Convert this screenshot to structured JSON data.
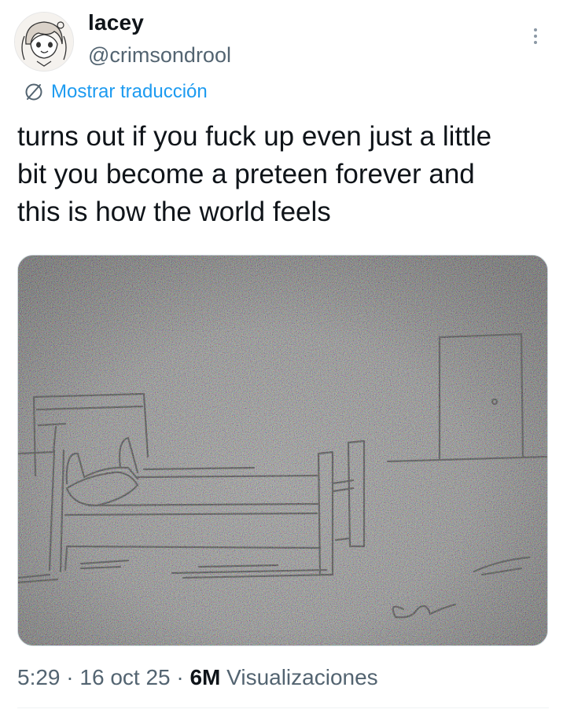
{
  "tweet": {
    "author": {
      "display_name": "lacey",
      "handle": "@crimsondrool",
      "avatar_icon": "anime-girl-avatar"
    },
    "more_icon": "more-options-icon",
    "translate": {
      "icon": "translate-globe-icon",
      "label": "Mostrar traducción",
      "color": "#1d9bf0"
    },
    "text_lines": [
      "turns out if you fuck up even just a little",
      "bit you become a preteen forever and",
      "this is how the world feels"
    ],
    "media": {
      "description_icon": "bed-sketch-drawing",
      "signature": "ck"
    },
    "meta": {
      "time": "5:29",
      "separator": "·",
      "date": "16 oct 25",
      "views_count": "6M",
      "views_label": "Visualizaciones"
    }
  }
}
